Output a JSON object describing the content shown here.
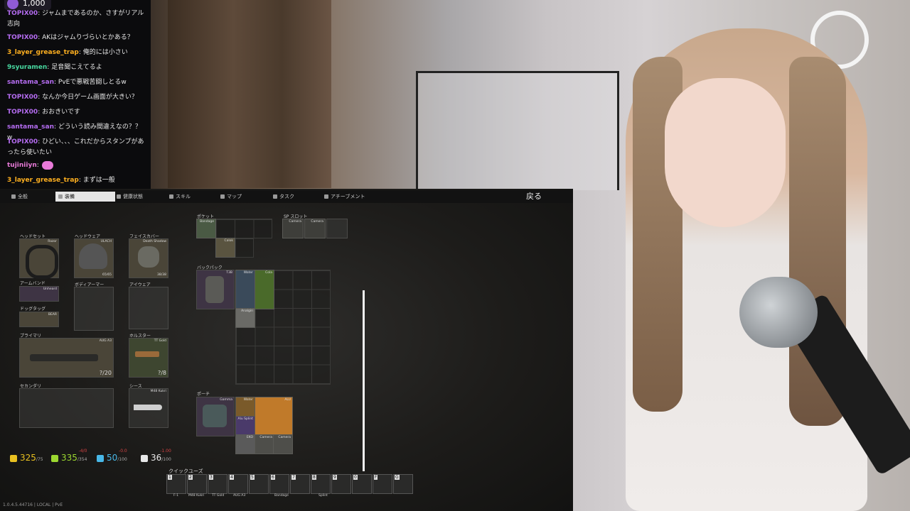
{
  "chat": {
    "badge": "1,000",
    "messages": [
      {
        "user": "TOPIX00",
        "text": ": ジャムまであるのか、さすがリアル",
        "color": "#b46cf0",
        "cont": "志向"
      },
      {
        "user": "TOPIX00",
        "text": ": AKはジャムりづらいとかある？",
        "color": "#b46cf0"
      },
      {
        "user": "3_layer_grease_trap",
        "text": ": 俺的には小さい",
        "color": "#ffb020"
      },
      {
        "user": "9syuramen",
        "text": ": 足音聞こえてるよ",
        "color": "#48d8a0"
      },
      {
        "user": "santama_san",
        "text": ": PvEで悪戦苦闘しとるw",
        "color": "#b46cf0"
      },
      {
        "user": "TOPIX00",
        "text": ": なんか今日ゲーム画面が大きい？",
        "color": "#b46cf0"
      },
      {
        "user": "TOPIX00",
        "text": ": おおきいです",
        "color": "#b46cf0"
      },
      {
        "user": "santama_san",
        "text": ": どういう読み間違えなの？？w",
        "color": "#b46cf0"
      },
      {
        "user": "TOPIX00",
        "text": ": ひどい、、、これだからスタンプがあ",
        "color": "#b46cf0",
        "cont": "ったら使いたい"
      },
      {
        "user": "tujiniiyn",
        "text": ":",
        "color": "#e87ad8"
      },
      {
        "user": "3_layer_grease_trap",
        "text": ": まずは一般",
        "color": "#ffb020"
      }
    ]
  },
  "game": {
    "tabs": [
      "全般",
      "装備",
      "健康状態",
      "スキル",
      "マップ",
      "タスク",
      "アチーブメント"
    ],
    "active_tab": "装備",
    "back_label": "戻る",
    "equipment": {
      "headset": {
        "label": "ヘッドセット",
        "item": "Razor"
      },
      "headwear": {
        "label": "ヘッドウェア",
        "item": "ULACH",
        "durability": "65/65"
      },
      "face_cover": {
        "label": "フェイスカバー",
        "item": "Death Shadow",
        "durability": "38/38"
      },
      "armband": {
        "label": "アームバンド",
        "item": "Unheard"
      },
      "body_armor": {
        "label": "ボディアーマー"
      },
      "eyewear": {
        "label": "アイウェア"
      },
      "dogtag": {
        "label": "ドッグタッグ",
        "item": "BEAR"
      },
      "primary": {
        "label": "プライマリ",
        "item": "AUG A3",
        "ammo": "?/20"
      },
      "holster": {
        "label": "ホルスター",
        "item": "TT Gold",
        "ammo": "?/8"
      },
      "secondary": {
        "label": "セカンダリ"
      },
      "sheath": {
        "label": "シース",
        "item": "M48 Kukri"
      }
    },
    "pockets": {
      "label": "ポケット",
      "items": [
        "Bandage",
        "Calok"
      ]
    },
    "sp_slots": {
      "label": "SP スロット",
      "items": [
        "Camera",
        "Camera"
      ]
    },
    "backpack": {
      "label": "バックパック",
      "item": "T3B",
      "items": [
        "Water",
        "Cola",
        "Analgin"
      ]
    },
    "pouch": {
      "label": "ポーチ",
      "item": "Gamma",
      "items": [
        "Water",
        "ALU",
        "Alu Splint",
        "EKO",
        "Splint",
        "Camera",
        "Camera"
      ]
    },
    "stats": [
      {
        "name": "weight",
        "value": "325",
        "max": "/75",
        "red": "",
        "color": "#e8c020"
      },
      {
        "name": "energy",
        "value": "335",
        "max": "/354",
        "red": "-4/0",
        "color": "#9cd830"
      },
      {
        "name": "hydration",
        "value": "50",
        "max": "/100",
        "red": "-0.0",
        "color": "#48b8e8"
      },
      {
        "name": "hydro2",
        "value": "36",
        "max": "/100",
        "red": "-1.00",
        "color": "#e8e8e8"
      }
    ],
    "quickuse": {
      "label": "クイックユーズ",
      "slots": [
        "1",
        "2",
        "3",
        "4",
        "5",
        "6",
        "7",
        "8",
        "9",
        "0",
        "F",
        "G",
        "H",
        "J"
      ],
      "item_labels": [
        "F-1",
        "M48 Kukri",
        "TT Gold",
        "AUG A3",
        "Bandage",
        "Splint"
      ]
    },
    "version": "1.0.4.5.44716 | LOCAL | PvE"
  }
}
